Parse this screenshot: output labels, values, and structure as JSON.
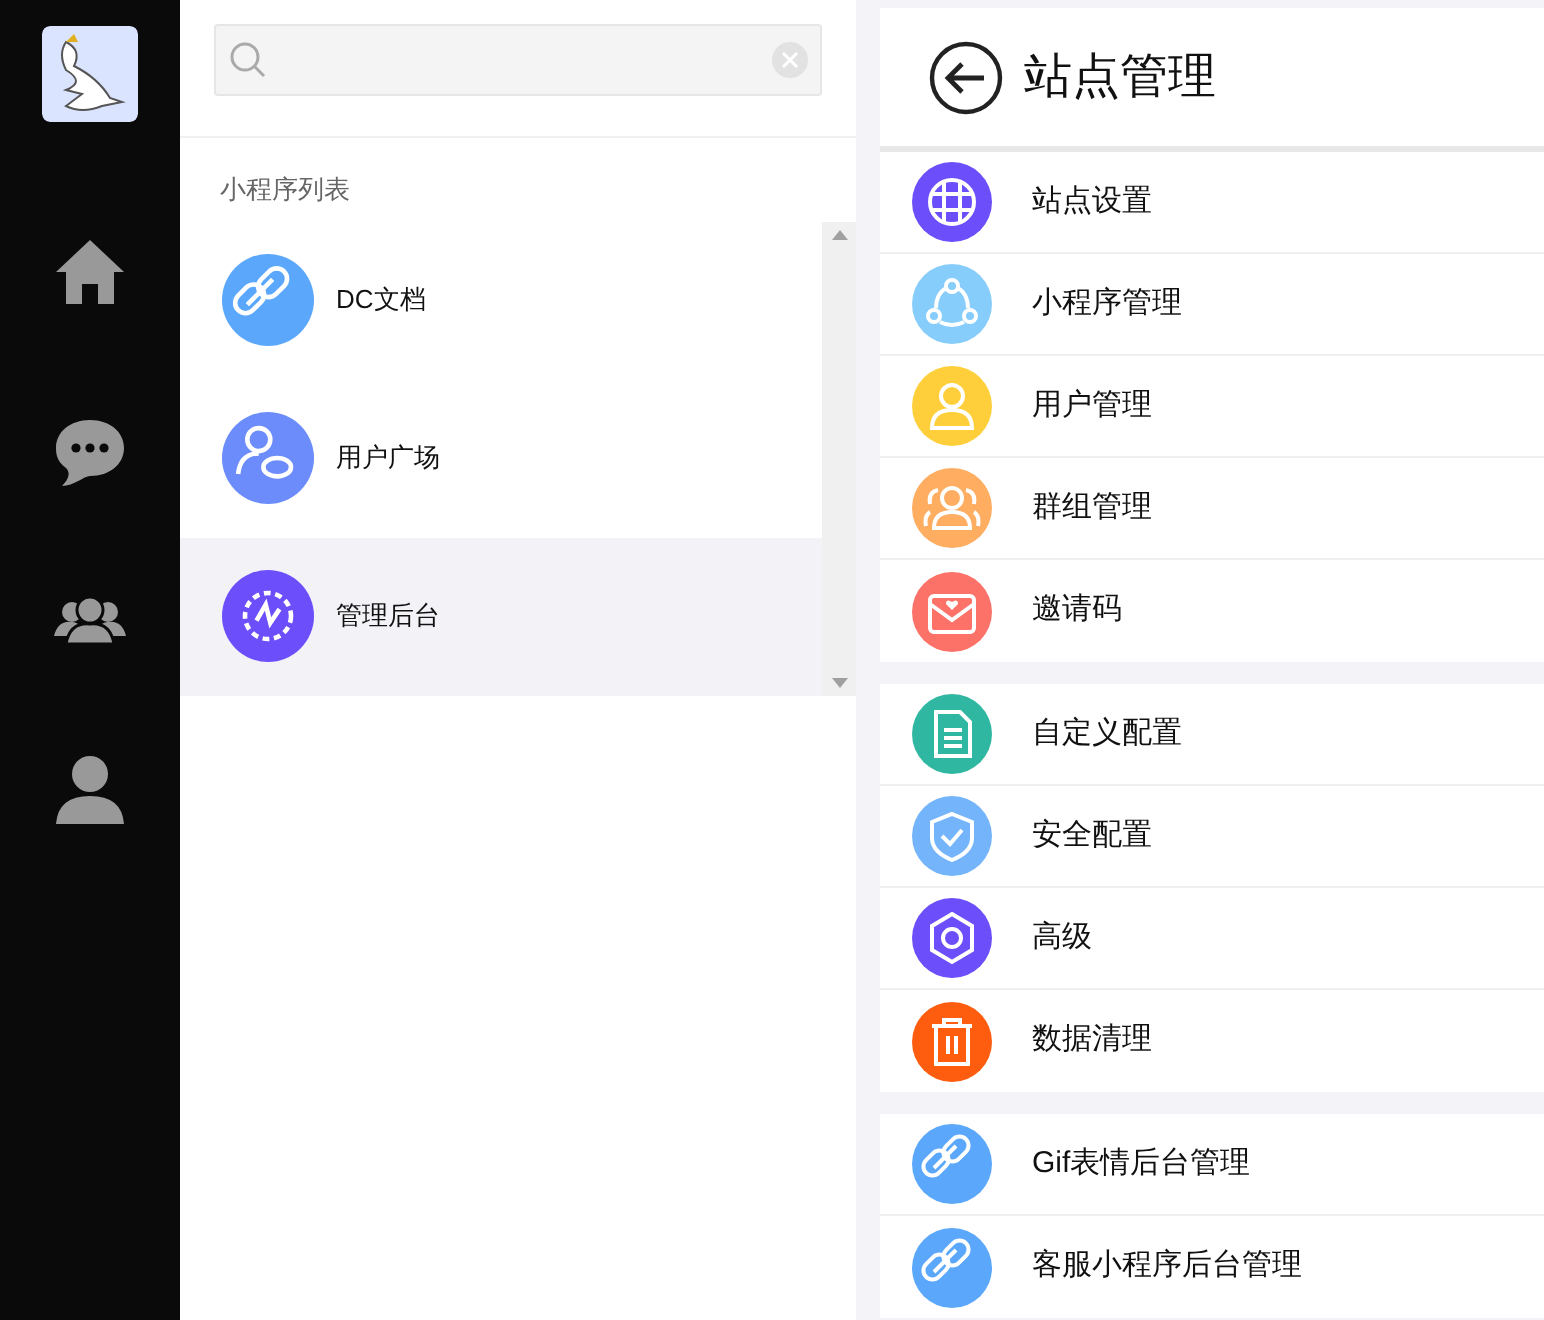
{
  "rail": {
    "items": [
      {
        "kind": "home"
      },
      {
        "kind": "chat"
      },
      {
        "kind": "group"
      },
      {
        "kind": "person"
      }
    ]
  },
  "app_list": {
    "title": "小程序列表",
    "items": [
      {
        "label": "DC文档",
        "kind": "link",
        "color": "#5aa7fb",
        "selected": false
      },
      {
        "label": "用户广场",
        "kind": "user-planet",
        "color": "#6b8cfa",
        "selected": false
      },
      {
        "label": "管理后台",
        "kind": "gear-chart",
        "color": "#6c4efb",
        "selected": true
      }
    ]
  },
  "page": {
    "title": "站点管理",
    "groups": [
      {
        "items": [
          {
            "label": "站点设置",
            "kind": "globe",
            "color": "#6c4ffa"
          },
          {
            "label": "小程序管理",
            "kind": "nodes",
            "color": "#87cdfb"
          },
          {
            "label": "用户管理",
            "kind": "user",
            "color": "#fecf3a"
          },
          {
            "label": "群组管理",
            "kind": "group",
            "color": "#fead61"
          },
          {
            "label": "邀请码",
            "kind": "envelope",
            "color": "#fc7268"
          }
        ]
      },
      {
        "items": [
          {
            "label": "自定义配置",
            "kind": "document",
            "color": "#30b7a1"
          },
          {
            "label": "安全配置",
            "kind": "shield",
            "color": "#73b4fa"
          },
          {
            "label": "高级",
            "kind": "gear",
            "color": "#6c4ffa"
          },
          {
            "label": "数据清理",
            "kind": "trash",
            "color": "#fe5c0f"
          }
        ]
      },
      {
        "items": [
          {
            "label": "Gif表情后台管理",
            "kind": "link",
            "color": "#5aa7fb"
          },
          {
            "label": "客服小程序后台管理",
            "kind": "link",
            "color": "#5aa7fb"
          }
        ]
      }
    ]
  }
}
